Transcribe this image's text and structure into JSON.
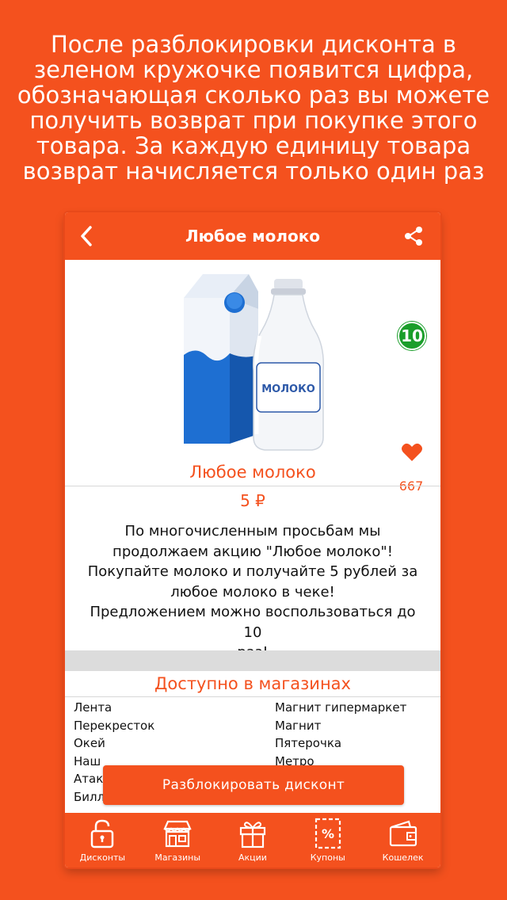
{
  "intro": {
    "lines": [
      "После разблокировки дисконта  в",
      "зеленом кружочке появится цифра,",
      "обозначающая сколько раз вы можете",
      "получить возврат при покупке этого",
      "товара. За каждую единицу товара",
      "возврат начисляется только один раз"
    ]
  },
  "navbar": {
    "title": "Любое молоко",
    "back_icon": "chevron-left-icon",
    "share_icon": "share-icon"
  },
  "product": {
    "image_label": "МОЛОКО",
    "badge_count": "10",
    "likes": "667",
    "name": "Любое молоко",
    "price": "5 ₽",
    "description_lines": [
      "По многочисленным просьбам мы",
      "продолжаем акцию \"Любое молоко\"!",
      "Покупайте молоко и получайте 5 рублей за",
      "любое молоко в чеке!",
      "Предложением можно воспользоваться до 10",
      "раз!"
    ]
  },
  "stores": {
    "title": "Доступно в магазинах",
    "rows": [
      [
        "Лента",
        "Магнит гипермаркет"
      ],
      [
        "Перекресток",
        "Магнит"
      ],
      [
        "Окей",
        "Пятерочка"
      ],
      [
        "Наш",
        "Метро"
      ],
      [
        "Атак",
        ""
      ],
      [
        "Билл",
        ""
      ]
    ]
  },
  "actions": {
    "unlock_label": "Разблокировать дисконт"
  },
  "tabbar": {
    "items": [
      {
        "label": "Дисконты",
        "icon": "padlock-icon"
      },
      {
        "label": "Магазины",
        "icon": "store-icon"
      },
      {
        "label": "Акции",
        "icon": "gift-icon"
      },
      {
        "label": "Купоны",
        "icon": "coupon-icon"
      },
      {
        "label": "Кошелек",
        "icon": "wallet-icon"
      }
    ]
  },
  "colors": {
    "accent": "#f4511e",
    "badge": "#1a9e2a"
  }
}
